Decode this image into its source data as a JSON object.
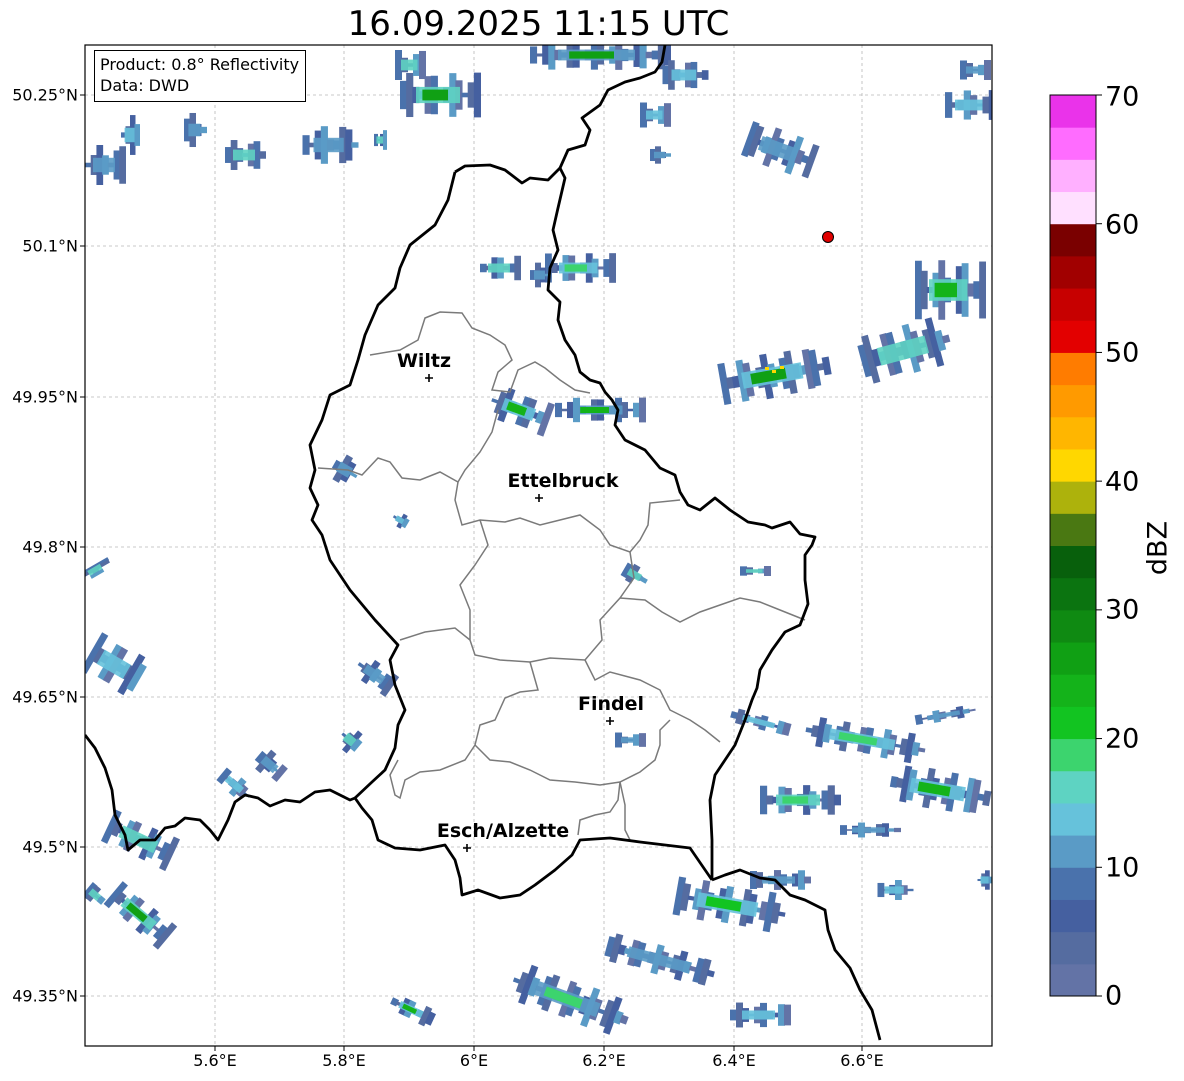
{
  "title": "16.09.2025 11:15 UTC",
  "info": {
    "product": "Product: 0.8° Reflectivity",
    "source": "Data: DWD"
  },
  "axes": {
    "y_ticks": [
      "50.25°N",
      "50.1°N",
      "49.95°N",
      "49.8°N",
      "49.65°N",
      "49.5°N",
      "49.35°N"
    ],
    "x_ticks": [
      "5.6°E",
      "5.8°E",
      "6°E",
      "6.2°E",
      "6.4°E",
      "6.6°E"
    ]
  },
  "colorbar": {
    "label": "dBZ",
    "ticks": [
      "0",
      "10",
      "20",
      "30",
      "40",
      "50",
      "60",
      "70"
    ],
    "colors": [
      "#6373a6",
      "#556ca0",
      "#4560a0",
      "#4a72ac",
      "#5a9bc6",
      "#66c2db",
      "#5ed3c2",
      "#3cd46e",
      "#12c421",
      "#14b31a",
      "#10a014",
      "#0f8a12",
      "#0b7410",
      "#08600c",
      "#4a7812",
      "#adb20c",
      "#ffd700",
      "#ffb600",
      "#ff9a00",
      "#ff7c00",
      "#e30000",
      "#c70000",
      "#a10000",
      "#7a0000",
      "#ffe0ff",
      "#ffb0ff",
      "#ff6cff",
      "#ea33ea"
    ]
  },
  "cities": [
    {
      "name": "Wiltz"
    },
    {
      "name": "Ettelbruck"
    },
    {
      "name": "Findel"
    },
    {
      "name": "Esch/Alzette"
    }
  ],
  "radar_marker_color": "#e00000"
}
